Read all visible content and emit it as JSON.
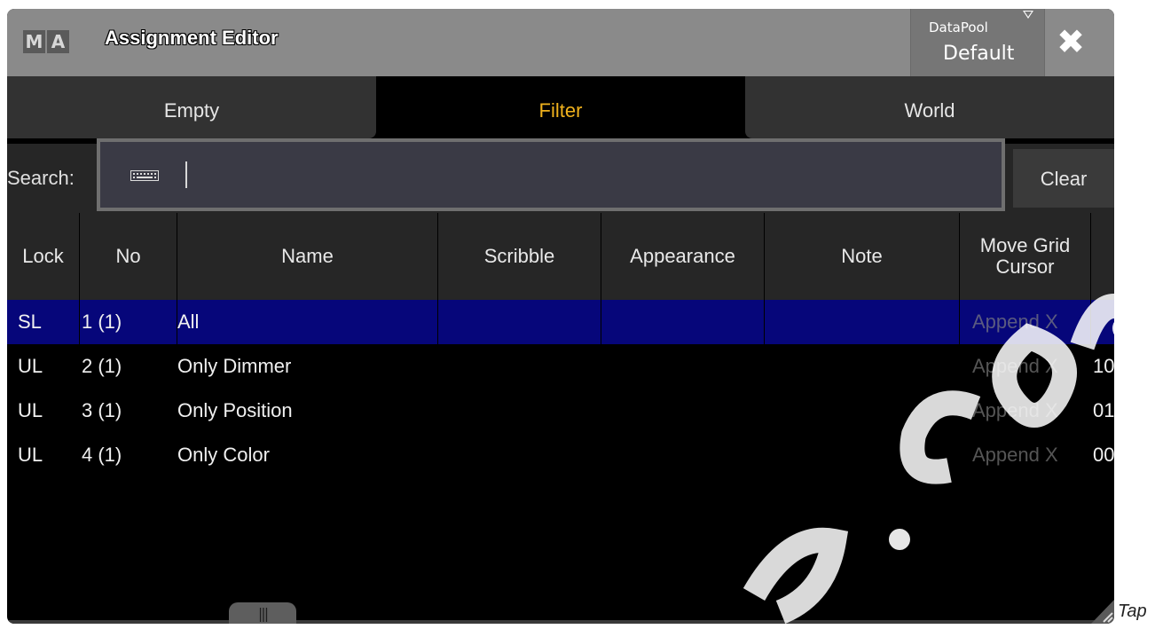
{
  "window": {
    "logo": [
      "M",
      "A"
    ],
    "title": "Assignment Editor",
    "datapool": {
      "label": "DataPool",
      "value": "Default"
    },
    "close_icon": "close-icon"
  },
  "tabs": [
    {
      "label": "Empty",
      "active": false
    },
    {
      "label": "Filter",
      "active": true
    },
    {
      "label": "World",
      "active": false
    }
  ],
  "search": {
    "label": "Search:",
    "value": "",
    "clear_label": "Clear",
    "icon": "keyboard-icon"
  },
  "table": {
    "columns": [
      "Lock",
      "No",
      "Name",
      "Scribble",
      "Appearance",
      "Note",
      "Move Grid Cursor"
    ],
    "rows": [
      {
        "lock": "SL",
        "no": "1 (1)",
        "name": "All",
        "scribble": "",
        "appearance": "",
        "note": "",
        "move_grid": "Append X",
        "extra": "",
        "selected": true
      },
      {
        "lock": "UL",
        "no": "2 (1)",
        "name": "Only Dimmer",
        "scribble": "",
        "appearance": "",
        "note": "",
        "move_grid": "Append X",
        "extra": "10",
        "selected": false
      },
      {
        "lock": "UL",
        "no": "3 (1)",
        "name": "Only Position",
        "scribble": "",
        "appearance": "",
        "note": "",
        "move_grid": "Append X",
        "extra": "01",
        "selected": false
      },
      {
        "lock": "UL",
        "no": "4 (1)",
        "name": "Only Color",
        "scribble": "",
        "appearance": "",
        "note": "",
        "move_grid": "Append X",
        "extra": "00",
        "selected": false
      }
    ]
  },
  "footer": {
    "handle_glyph": "|||",
    "outside_text": "Tap"
  },
  "colors": {
    "accent": "#f0b21d",
    "selection": "#06067a",
    "titlebar": "#8a8a8a"
  }
}
